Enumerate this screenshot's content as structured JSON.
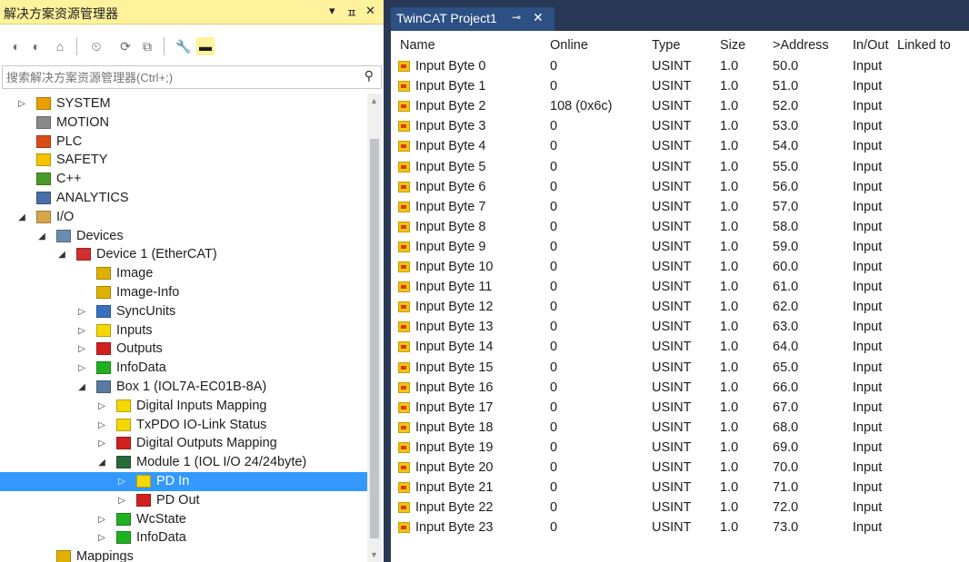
{
  "left_pane": {
    "title": "解决方案资源管理器",
    "dropdown_glyph": "▾",
    "pin_glyph": "ㅍ",
    "close_glyph": "✕",
    "toolbar": [
      {
        "name": "back-icon",
        "glyph": "◐"
      },
      {
        "name": "forward-icon",
        "glyph": "◐"
      },
      {
        "name": "home-icon",
        "glyph": "⌂"
      },
      {
        "name": "history-icon",
        "glyph": "⏲"
      },
      {
        "name": "refresh-icon",
        "glyph": "⟳"
      },
      {
        "name": "collapse-all-icon",
        "glyph": "⧉"
      },
      {
        "name": "properties-icon",
        "glyph": "🔧"
      },
      {
        "name": "preview-icon",
        "glyph": "▬"
      }
    ],
    "search": {
      "placeholder": "搜索解决方案资源管理器(Ctrl+;)",
      "icon_glyph": "⚲"
    },
    "tree": [
      {
        "label": "SYSTEM",
        "arrow": "▷",
        "level": 0,
        "icon": "system-icon",
        "color": "#e8a000"
      },
      {
        "label": "MOTION",
        "arrow": "",
        "level": 0,
        "icon": "motion-icon",
        "color": "#8a8a8a"
      },
      {
        "label": "PLC",
        "arrow": "",
        "level": 0,
        "icon": "plc-icon",
        "color": "#d94d1a"
      },
      {
        "label": "SAFETY",
        "arrow": "",
        "level": 0,
        "icon": "safety-icon",
        "color": "#f5c400"
      },
      {
        "label": "C++",
        "arrow": "",
        "level": 0,
        "icon": "cpp-icon",
        "color": "#4a9a2a"
      },
      {
        "label": "ANALYTICS",
        "arrow": "",
        "level": 0,
        "icon": "analytics-icon",
        "color": "#4a6ea8"
      },
      {
        "label": "I/O",
        "arrow": "◢",
        "level": 0,
        "icon": "io-icon",
        "color": "#d6a64a"
      },
      {
        "label": "Devices",
        "arrow": "◢",
        "level": 1,
        "icon": "devices-icon",
        "color": "#6a8cb0"
      },
      {
        "label": "Device 1 (EtherCAT)",
        "arrow": "◢",
        "level": 2,
        "icon": "ethercat-device-icon",
        "color": "#d03030"
      },
      {
        "label": "Image",
        "arrow": "",
        "level": 3,
        "icon": "image-icon",
        "color": "#e0b000"
      },
      {
        "label": "Image-Info",
        "arrow": "",
        "level": 3,
        "icon": "image-info-icon",
        "color": "#e0b000"
      },
      {
        "label": "SyncUnits",
        "arrow": "▷",
        "level": 3,
        "icon": "syncunits-icon",
        "color": "#3a70c0"
      },
      {
        "label": "Inputs",
        "arrow": "▷",
        "level": 3,
        "icon": "inputs-icon",
        "color": "#f5d800"
      },
      {
        "label": "Outputs",
        "arrow": "▷",
        "level": 3,
        "icon": "outputs-icon",
        "color": "#d02020"
      },
      {
        "label": "InfoData",
        "arrow": "▷",
        "level": 3,
        "icon": "infodata-icon",
        "color": "#20b020"
      },
      {
        "label": "Box 1 (IOL7A-EC01B-8A)",
        "arrow": "◢",
        "level": 3,
        "icon": "box-icon",
        "color": "#5a7aa0"
      },
      {
        "label": "Digital Inputs Mapping",
        "arrow": "▷",
        "level": 4,
        "icon": "digital-inputs-icon",
        "color": "#f5d800"
      },
      {
        "label": "TxPDO IO-Link Status",
        "arrow": "▷",
        "level": 4,
        "icon": "txpdo-icon",
        "color": "#f5d800"
      },
      {
        "label": "Digital Outputs Mapping",
        "arrow": "▷",
        "level": 4,
        "icon": "digital-outputs-icon",
        "color": "#d02020"
      },
      {
        "label": "Module 1 (IOL I/O 24/24byte)",
        "arrow": "◢",
        "level": 4,
        "icon": "module-icon",
        "color": "#2a6a3a"
      },
      {
        "label": "PD In",
        "arrow": "▷",
        "level": 5,
        "icon": "pd-in-icon",
        "color": "#f5d800",
        "selected": true
      },
      {
        "label": "PD Out",
        "arrow": "▷",
        "level": 5,
        "icon": "pd-out-icon",
        "color": "#d02020"
      },
      {
        "label": "WcState",
        "arrow": "▷",
        "level": 4,
        "icon": "wcstate-icon",
        "color": "#20b020"
      },
      {
        "label": "InfoData",
        "arrow": "▷",
        "level": 4,
        "icon": "infodata-icon",
        "color": "#20b020"
      },
      {
        "label": "Mappings",
        "arrow": "",
        "level": 1,
        "icon": "mappings-icon",
        "color": "#e0b000"
      }
    ]
  },
  "document": {
    "tab_label": "TwinCAT Project1",
    "tab_pin": "⊸",
    "tab_close": "✕",
    "columns": [
      "Name",
      "Online",
      "Type",
      "Size",
      ">Address",
      "In/Out",
      "Linked to"
    ],
    "rows": [
      [
        "Input Byte 0",
        "0",
        "USINT",
        "1.0",
        "50.0",
        "Input",
        ""
      ],
      [
        "Input Byte 1",
        "0",
        "USINT",
        "1.0",
        "51.0",
        "Input",
        ""
      ],
      [
        "Input Byte 2",
        "108 (0x6c)",
        "USINT",
        "1.0",
        "52.0",
        "Input",
        ""
      ],
      [
        "Input Byte 3",
        "0",
        "USINT",
        "1.0",
        "53.0",
        "Input",
        ""
      ],
      [
        "Input Byte 4",
        "0",
        "USINT",
        "1.0",
        "54.0",
        "Input",
        ""
      ],
      [
        "Input Byte 5",
        "0",
        "USINT",
        "1.0",
        "55.0",
        "Input",
        ""
      ],
      [
        "Input Byte 6",
        "0",
        "USINT",
        "1.0",
        "56.0",
        "Input",
        ""
      ],
      [
        "Input Byte 7",
        "0",
        "USINT",
        "1.0",
        "57.0",
        "Input",
        ""
      ],
      [
        "Input Byte 8",
        "0",
        "USINT",
        "1.0",
        "58.0",
        "Input",
        ""
      ],
      [
        "Input Byte 9",
        "0",
        "USINT",
        "1.0",
        "59.0",
        "Input",
        ""
      ],
      [
        "Input Byte 10",
        "0",
        "USINT",
        "1.0",
        "60.0",
        "Input",
        ""
      ],
      [
        "Input Byte 11",
        "0",
        "USINT",
        "1.0",
        "61.0",
        "Input",
        ""
      ],
      [
        "Input Byte 12",
        "0",
        "USINT",
        "1.0",
        "62.0",
        "Input",
        ""
      ],
      [
        "Input Byte 13",
        "0",
        "USINT",
        "1.0",
        "63.0",
        "Input",
        ""
      ],
      [
        "Input Byte 14",
        "0",
        "USINT",
        "1.0",
        "64.0",
        "Input",
        ""
      ],
      [
        "Input Byte 15",
        "0",
        "USINT",
        "1.0",
        "65.0",
        "Input",
        ""
      ],
      [
        "Input Byte 16",
        "0",
        "USINT",
        "1.0",
        "66.0",
        "Input",
        ""
      ],
      [
        "Input Byte 17",
        "0",
        "USINT",
        "1.0",
        "67.0",
        "Input",
        ""
      ],
      [
        "Input Byte 18",
        "0",
        "USINT",
        "1.0",
        "68.0",
        "Input",
        ""
      ],
      [
        "Input Byte 19",
        "0",
        "USINT",
        "1.0",
        "69.0",
        "Input",
        ""
      ],
      [
        "Input Byte 20",
        "0",
        "USINT",
        "1.0",
        "70.0",
        "Input",
        ""
      ],
      [
        "Input Byte 21",
        "0",
        "USINT",
        "1.0",
        "71.0",
        "Input",
        ""
      ],
      [
        "Input Byte 22",
        "0",
        "USINT",
        "1.0",
        "72.0",
        "Input",
        ""
      ],
      [
        "Input Byte 23",
        "0",
        "USINT",
        "1.0",
        "73.0",
        "Input",
        ""
      ]
    ]
  },
  "colors": {
    "title_bar": "#fff29d",
    "selection": "#3399ff",
    "dark_chrome": "#293955",
    "active_tab": "#2d5084"
  }
}
